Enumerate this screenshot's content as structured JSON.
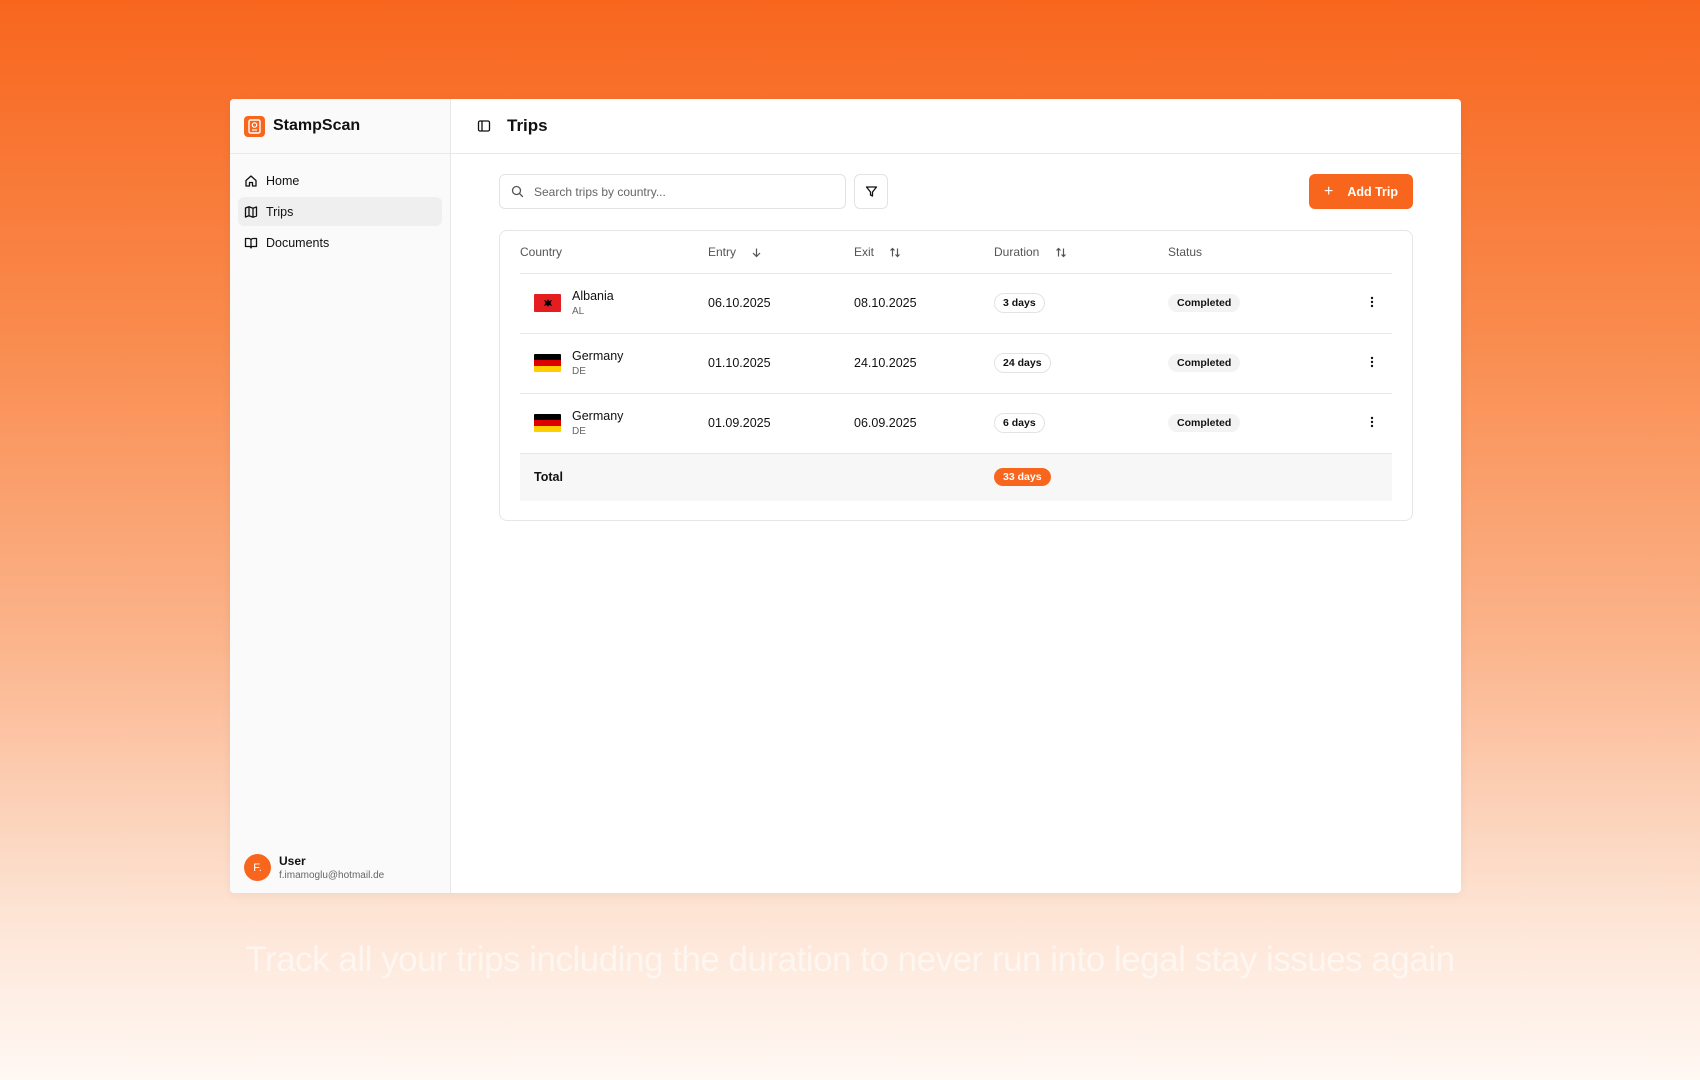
{
  "app": {
    "name": "StampScan"
  },
  "sidebar": {
    "items": [
      {
        "label": "Home",
        "icon": "home-icon"
      },
      {
        "label": "Trips",
        "icon": "map-icon",
        "active": true
      },
      {
        "label": "Documents",
        "icon": "book-open-icon"
      }
    ],
    "user": {
      "avatar": "F.",
      "name": "User",
      "email": "f.imamoglu@hotmail.de"
    }
  },
  "header": {
    "title": "Trips"
  },
  "toolbar": {
    "search_placeholder": "Search trips by country...",
    "add_label": "Add Trip"
  },
  "table": {
    "columns": [
      "Country",
      "Entry",
      "Exit",
      "Duration",
      "Status"
    ],
    "rows": [
      {
        "country": "Albania",
        "code": "AL",
        "entry": "06.10.2025",
        "exit": "08.10.2025",
        "duration": "3 days",
        "status": "Completed"
      },
      {
        "country": "Germany",
        "code": "DE",
        "entry": "01.10.2025",
        "exit": "24.10.2025",
        "duration": "24 days",
        "status": "Completed"
      },
      {
        "country": "Germany",
        "code": "DE",
        "entry": "01.09.2025",
        "exit": "06.09.2025",
        "duration": "6 days",
        "status": "Completed"
      }
    ],
    "total": {
      "label": "Total",
      "value": "33 days"
    }
  },
  "tagline": "Track all your trips including the duration to never run into legal stay issues again",
  "colors": {
    "accent": "#f8661e"
  }
}
